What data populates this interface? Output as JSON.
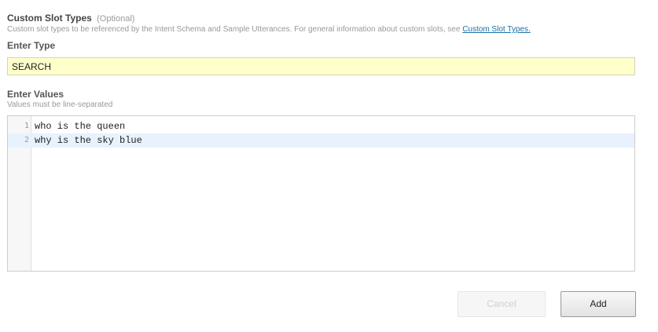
{
  "section": {
    "title": "Custom Slot Types",
    "optional": "(Optional)",
    "description": "Custom slot types to be referenced by the Intent Schema and Sample Utterances. For general information about custom slots, see ",
    "link_text": "Custom Slot Types."
  },
  "type_field": {
    "label": "Enter Type",
    "value": "SEARCH"
  },
  "values_field": {
    "label": "Enter Values",
    "hint": "Values must be line-separated",
    "lines": [
      {
        "number": "1",
        "text": "who is the queen"
      },
      {
        "number": "2",
        "text": "why is the sky blue"
      }
    ]
  },
  "buttons": {
    "cancel": "Cancel",
    "add": "Add"
  }
}
